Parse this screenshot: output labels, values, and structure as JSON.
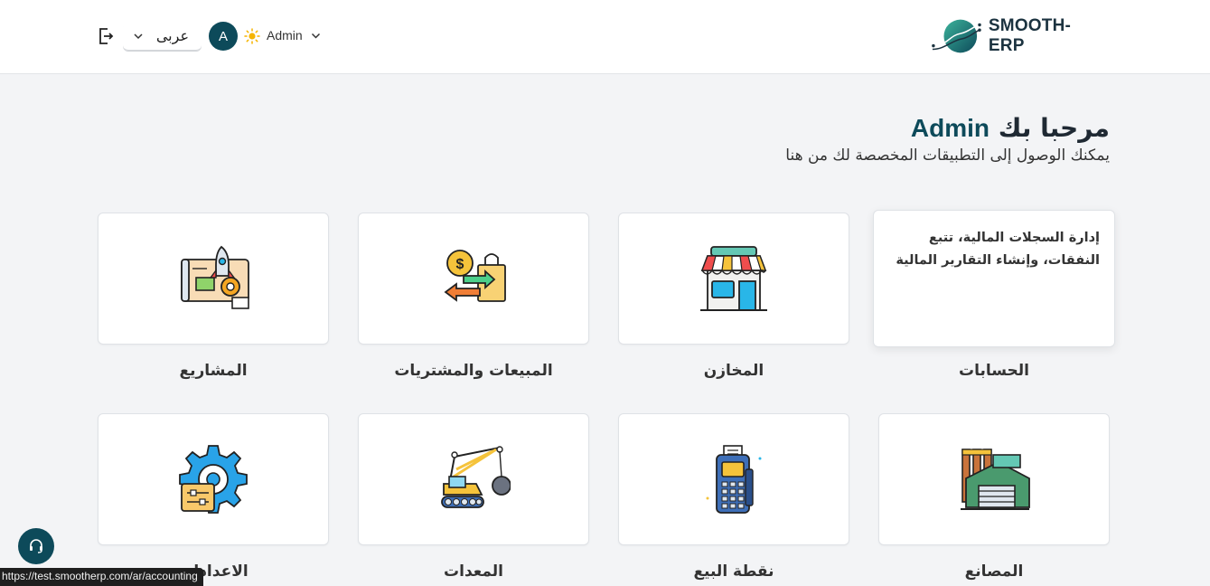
{
  "header": {
    "logo_text": "SMOOTH-ERP",
    "language_label": "عربى",
    "avatar_letter": "A",
    "user_name": "Admin"
  },
  "welcome": {
    "greeting": "مرحبا بك",
    "name": "Admin",
    "subtitle": "يمكنك الوصول إلى التطبيقات المخصصة لك من هنا"
  },
  "apps": [
    {
      "label": "الحسابات",
      "icon": "accounting-icon",
      "description": "إدارة السجلات المالية، تتبع النفقات، وإنشاء التقارير المالية"
    },
    {
      "label": "المخازن",
      "icon": "store-icon"
    },
    {
      "label": "المبيعات والمشتريات",
      "icon": "sales-purchases-icon"
    },
    {
      "label": "المشاريع",
      "icon": "projects-icon"
    },
    {
      "label": "المصانع",
      "icon": "factory-icon"
    },
    {
      "label": "نقطة البيع",
      "icon": "pos-terminal-icon"
    },
    {
      "label": "المعدات",
      "icon": "crane-icon"
    },
    {
      "label": "الاعدادات",
      "icon": "settings-gear-icon"
    }
  ],
  "status_url": "https://test.smootherp.com/ar/accounting",
  "colors": {
    "brand": "#0d4a5a",
    "background": "#f3f4f6"
  }
}
